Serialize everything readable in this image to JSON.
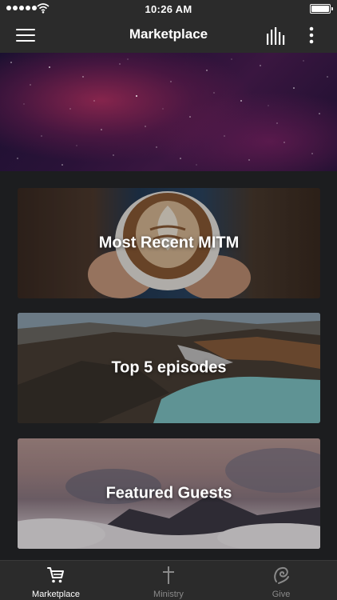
{
  "status_bar": {
    "time": "10:26 AM",
    "signal_icon": "signal-dots-icon",
    "wifi_icon": "wifi-icon",
    "battery_icon": "battery-full-icon"
  },
  "nav_bar": {
    "title": "Marketplace",
    "menu_icon": "hamburger-menu-icon",
    "chart_icon": "bar-chart-icon",
    "more_icon": "vertical-ellipsis-icon"
  },
  "hero": {
    "image": "starry-night-sky"
  },
  "cards": [
    {
      "label": "Most Recent MITM",
      "image": "latte-art-coffee-cup"
    },
    {
      "label": "Top 5 episodes",
      "image": "volcanic-crater-lake"
    },
    {
      "label": "Featured Guests",
      "image": "mountain-peaks-above-clouds"
    }
  ],
  "tab_bar": {
    "tabs": [
      {
        "label": "Marketplace",
        "icon": "shopping-cart-icon",
        "active": true
      },
      {
        "label": "Ministry",
        "icon": "cross-icon",
        "active": false
      },
      {
        "label": "Give",
        "icon": "give-swirl-icon",
        "active": false
      }
    ]
  },
  "colors": {
    "bar_background": "#2b2b2b",
    "content_background": "#1c1d1f",
    "active_tab": "#ffffff",
    "inactive_tab": "#8a8a8a"
  }
}
